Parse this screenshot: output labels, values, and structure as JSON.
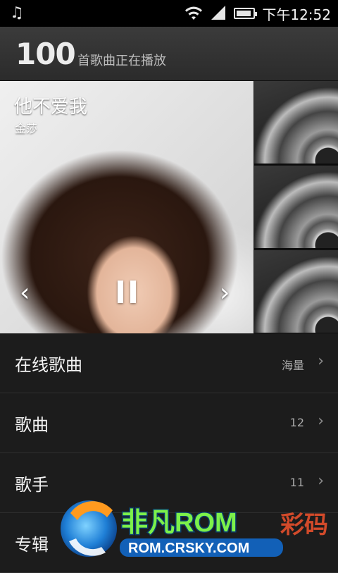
{
  "status_bar": {
    "music_icon": "music-note-icon",
    "time": "下午12:52"
  },
  "header": {
    "count": "100",
    "label": "首歌曲正在播放"
  },
  "now_playing": {
    "song": "他不爱我",
    "artist": "金莎",
    "prev_icon": "chevron-left-icon",
    "next_icon": "chevron-right-icon",
    "pause_icon": "pause-icon"
  },
  "list": {
    "items": [
      {
        "label": "在线歌曲",
        "badge": "海量"
      },
      {
        "label": "歌曲",
        "badge": "12"
      },
      {
        "label": "歌手",
        "badge": "11"
      },
      {
        "label": "专辑",
        "badge": ""
      }
    ]
  },
  "watermark": {
    "brand": "非凡ROM",
    "brand_suffix": "彩码",
    "url": "ROM.CRSKY.COM"
  },
  "colors": {
    "background": "#1b1b1b",
    "header": "#333333",
    "text": "#f2f2f2",
    "secondary_text": "#a9a9a9"
  }
}
